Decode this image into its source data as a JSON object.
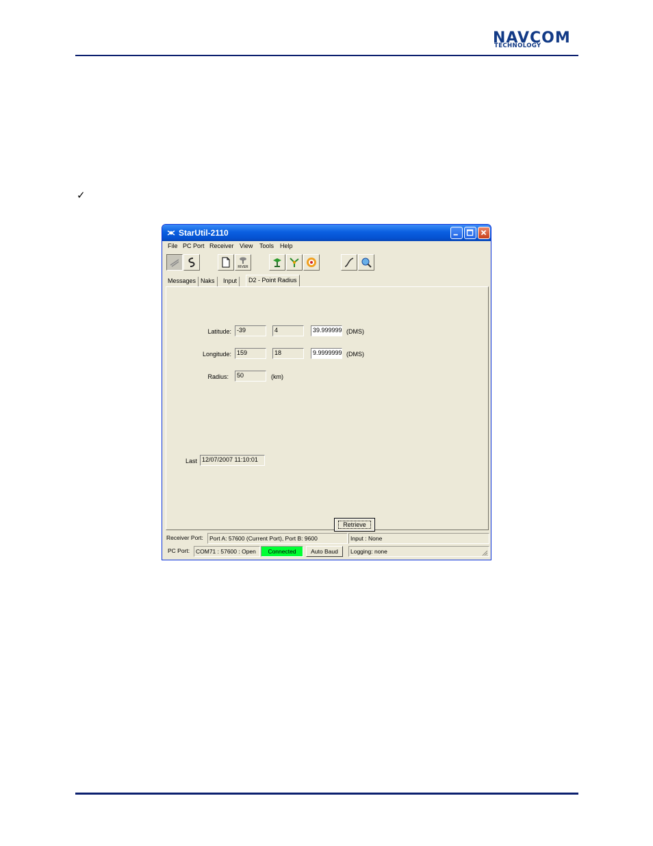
{
  "page": {
    "logo_line1": "NAVCOM",
    "logo_line2": "TECHNOLOGY",
    "checkmark": "✓"
  },
  "window": {
    "title": "StarUtil-2110",
    "menu": [
      "File",
      "PC Port",
      "Receiver",
      "View",
      "Tools",
      "Help"
    ],
    "toolbar_river_label": "RIVER",
    "tabs": [
      "Messages",
      "Naks",
      "Input",
      "D2 - Point Radius"
    ],
    "active_tab": "D2 - Point Radius",
    "form": {
      "latitude_label": "Latitude:",
      "latitude": [
        "-39",
        "4",
        "39.999999"
      ],
      "longitude_label": "Longitude:",
      "longitude": [
        "159",
        "18",
        "9.9999999"
      ],
      "dms_unit": "(DMS)",
      "radius_label": "Radius:",
      "radius": "50",
      "radius_unit": "(km)",
      "last_label": "Last",
      "last_value": "12/07/2007 11:10:01",
      "retrieve_label": "Retrieve"
    },
    "status": {
      "receiver_port_label": "Receiver Port:",
      "receiver_port_value": "Port A: 57600 (Current Port), Port B: 9600",
      "input_value": "Input : None",
      "pc_port_label": "PC Port:",
      "pc_port_value": "COM71 : 57600 : Open",
      "connected": "Connected",
      "auto_baud": "Auto Baud",
      "logging": "Logging: none",
      "connected_color": "#00ff33"
    }
  }
}
